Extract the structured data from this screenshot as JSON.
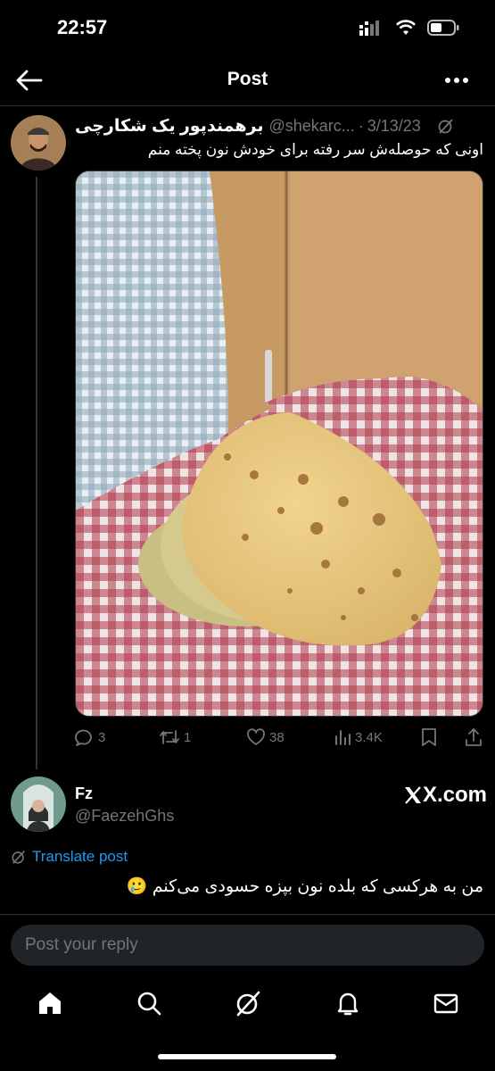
{
  "status_bar": {
    "time": "22:57"
  },
  "header": {
    "title": "Post"
  },
  "tweet": {
    "author_name": "برهمندپور یک شکارچی",
    "handle": "@shekarc...",
    "separator": "·",
    "date": "3/13/23",
    "text": "اونی که حوصله‌ش سر رفته برای خودش نون پخته منم",
    "actions": {
      "replies": "3",
      "reposts": "1",
      "likes": "38",
      "views": "3.4K"
    }
  },
  "reply": {
    "author_name": "Fz",
    "handle": "@FaezehGhs",
    "watermark": "X.com",
    "translate_label": "Translate post",
    "text": "من به هرکسی که بلده نون بپزه حسودی می‌کنم 🥲"
  },
  "composer": {
    "placeholder": "Post your reply"
  },
  "colors": {
    "background": "#000000",
    "accent": "#1d9bf0",
    "muted": "#71767b"
  }
}
